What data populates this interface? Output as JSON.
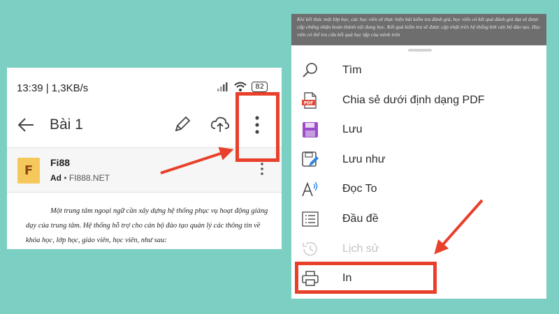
{
  "phone": {
    "status_text": "13:39 | 1,3KB/s",
    "battery": "82",
    "title": "Bài 1",
    "ad": {
      "logo_letter": "F",
      "name": "Fi88",
      "badge": "Ad",
      "domain": "• FI888.NET"
    },
    "doc_text": "Một trung tâm ngoại ngữ cần xây dựng hệ thống phục vụ hoạt động giảng dạy của trung tâm. Hệ thống hỗ trợ cho cán bộ đào tạo quản lý các thông tin về khóa học, lớp học, giáo viên, học viên, như sau:"
  },
  "menu_panel": {
    "doc_header": "Khi kết thúc một lớp học, các học viên sẽ thực hiện bài kiểm tra đánh giá, học viên có kết quả đánh giá đạt sẽ được cấp chứng nhận hoàn thành nội dung học. Kết quả kiểm tra sẽ được cập nhật trên hệ thống bởi cán bộ đào tạo. Học viên có thể tra cứu kết quả học tập của mình trên",
    "pdf_badge": "PDF",
    "items": [
      {
        "label": "Tìm",
        "icon": "search-icon",
        "enabled": true
      },
      {
        "label": "Chia sẻ dưới định dạng PDF",
        "icon": "pdf-share-icon",
        "enabled": true
      },
      {
        "label": "Lưu",
        "icon": "save-icon",
        "enabled": true
      },
      {
        "label": "Lưu như",
        "icon": "save-as-icon",
        "enabled": true
      },
      {
        "label": "Đọc To",
        "icon": "read-aloud-icon",
        "enabled": true
      },
      {
        "label": "Đầu đề",
        "icon": "headings-icon",
        "enabled": true
      },
      {
        "label": "Lịch sử",
        "icon": "history-icon",
        "enabled": false
      },
      {
        "label": "In",
        "icon": "print-icon",
        "enabled": true
      }
    ]
  },
  "colors": {
    "background": "#7ccfc3",
    "highlight": "#e8402a",
    "save_icon": "#9b4dca"
  }
}
